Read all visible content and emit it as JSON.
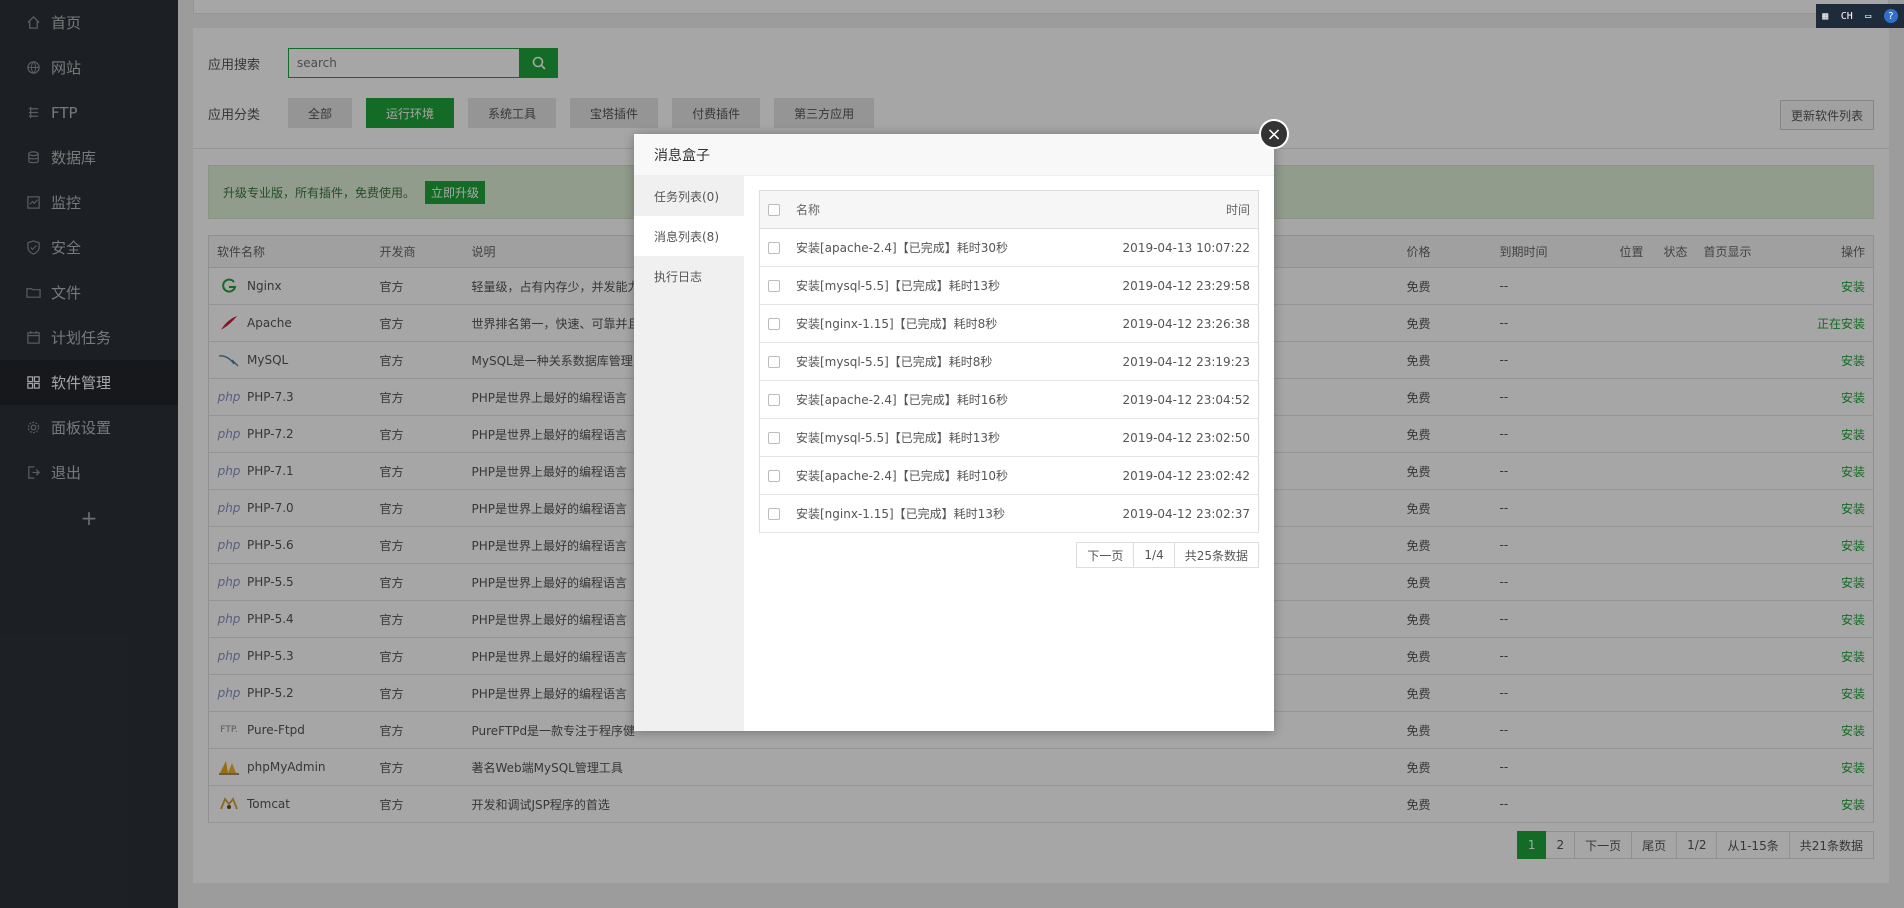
{
  "sidebar": {
    "items": [
      {
        "label": "首页",
        "icon": "home-icon"
      },
      {
        "label": "网站",
        "icon": "globe-icon"
      },
      {
        "label": "FTP",
        "icon": "ftp-icon"
      },
      {
        "label": "数据库",
        "icon": "database-icon"
      },
      {
        "label": "监控",
        "icon": "monitor-icon"
      },
      {
        "label": "安全",
        "icon": "shield-icon"
      },
      {
        "label": "文件",
        "icon": "folder-icon"
      },
      {
        "label": "计划任务",
        "icon": "calendar-icon"
      },
      {
        "label": "软件管理",
        "icon": "grid-icon",
        "active": true
      },
      {
        "label": "面板设置",
        "icon": "gear-icon"
      },
      {
        "label": "退出",
        "icon": "logout-icon"
      }
    ],
    "add_label": "+"
  },
  "search": {
    "label": "应用搜索",
    "placeholder": "search"
  },
  "categories": {
    "label": "应用分类",
    "items": [
      "全部",
      "运行环境",
      "系统工具",
      "宝塔插件",
      "付费插件",
      "第三方应用"
    ],
    "active": "运行环境"
  },
  "refresh_label": "更新软件列表",
  "promo": {
    "text": "升级专业版，所有插件，免费使用。",
    "button": "立即升级"
  },
  "software_table": {
    "headers": {
      "name": "软件名称",
      "vendor": "开发商",
      "desc": "说明",
      "price": "价格",
      "expire": "到期时间",
      "location": "位置",
      "status": "状态",
      "homepage": "首页显示",
      "action": "操作"
    },
    "rows": [
      {
        "name": "Nginx",
        "vendor": "官方",
        "desc": "轻量级，占有内存少，并发能力",
        "price": "免费",
        "expire": "--",
        "action": "安装",
        "logo": "G"
      },
      {
        "name": "Apache",
        "vendor": "官方",
        "desc": "世界排名第一，快速、可靠并且",
        "price": "免费",
        "expire": "--",
        "action": "正在安装",
        "logo": "feather"
      },
      {
        "name": "MySQL",
        "vendor": "官方",
        "desc": "MySQL是一种关系数据库管理",
        "price": "免费",
        "expire": "--",
        "action": "安装",
        "logo": "dolphin"
      },
      {
        "name": "PHP-7.3",
        "vendor": "官方",
        "desc": "PHP是世界上最好的编程语言",
        "price": "免费",
        "expire": "--",
        "action": "安装",
        "logo": "php"
      },
      {
        "name": "PHP-7.2",
        "vendor": "官方",
        "desc": "PHP是世界上最好的编程语言",
        "price": "免费",
        "expire": "--",
        "action": "安装",
        "logo": "php"
      },
      {
        "name": "PHP-7.1",
        "vendor": "官方",
        "desc": "PHP是世界上最好的编程语言",
        "price": "免费",
        "expire": "--",
        "action": "安装",
        "logo": "php"
      },
      {
        "name": "PHP-7.0",
        "vendor": "官方",
        "desc": "PHP是世界上最好的编程语言",
        "price": "免费",
        "expire": "--",
        "action": "安装",
        "logo": "php"
      },
      {
        "name": "PHP-5.6",
        "vendor": "官方",
        "desc": "PHP是世界上最好的编程语言",
        "price": "免费",
        "expire": "--",
        "action": "安装",
        "logo": "php"
      },
      {
        "name": "PHP-5.5",
        "vendor": "官方",
        "desc": "PHP是世界上最好的编程语言",
        "price": "免费",
        "expire": "--",
        "action": "安装",
        "logo": "php"
      },
      {
        "name": "PHP-5.4",
        "vendor": "官方",
        "desc": "PHP是世界上最好的编程语言",
        "price": "免费",
        "expire": "--",
        "action": "安装",
        "logo": "php"
      },
      {
        "name": "PHP-5.3",
        "vendor": "官方",
        "desc": "PHP是世界上最好的编程语言",
        "price": "免费",
        "expire": "--",
        "action": "安装",
        "logo": "php"
      },
      {
        "name": "PHP-5.2",
        "vendor": "官方",
        "desc": "PHP是世界上最好的编程语言",
        "price": "免费",
        "expire": "--",
        "action": "安装",
        "logo": "php"
      },
      {
        "name": "Pure-Ftpd",
        "vendor": "官方",
        "desc": "PureFTPd是一款专注于程序健",
        "price": "免费",
        "expire": "--",
        "action": "安装",
        "logo": "FTP"
      },
      {
        "name": "phpMyAdmin",
        "vendor": "官方",
        "desc": "著名Web端MySQL管理工具",
        "price": "免费",
        "expire": "--",
        "action": "安装",
        "logo": "sail"
      },
      {
        "name": "Tomcat",
        "vendor": "官方",
        "desc": "开发和调试JSP程序的首选",
        "price": "免费",
        "expire": "--",
        "action": "安装",
        "logo": "cat"
      }
    ]
  },
  "pager": {
    "items": [
      "1",
      "2",
      "下一页",
      "尾页",
      "1/2",
      "从1-15条",
      "共21条数据"
    ],
    "current": "1"
  },
  "modal": {
    "title": "消息盒子",
    "close": "×",
    "tabs": [
      "任务列表(0)",
      "消息列表(8)",
      "执行日志"
    ],
    "active_tab": "消息列表(8)",
    "table_headers": {
      "name": "名称",
      "time": "时间"
    },
    "messages": [
      {
        "name": "安装[apache-2.4]【已完成】耗时30秒",
        "time": "2019-04-13 10:07:22"
      },
      {
        "name": "安装[mysql-5.5]【已完成】耗时13秒",
        "time": "2019-04-12 23:29:58"
      },
      {
        "name": "安装[nginx-1.15]【已完成】耗时8秒",
        "time": "2019-04-12 23:26:38"
      },
      {
        "name": "安装[mysql-5.5]【已完成】耗时8秒",
        "time": "2019-04-12 23:19:23"
      },
      {
        "name": "安装[apache-2.4]【已完成】耗时16秒",
        "time": "2019-04-12 23:04:52"
      },
      {
        "name": "安装[mysql-5.5]【已完成】耗时13秒",
        "time": "2019-04-12 23:02:50"
      },
      {
        "name": "安装[apache-2.4]【已完成】耗时10秒",
        "time": "2019-04-12 23:02:42"
      },
      {
        "name": "安装[nginx-1.15]【已完成】耗时13秒",
        "time": "2019-04-12 23:02:37"
      }
    ],
    "pager": [
      "下一页",
      "1/4",
      "共25条数据"
    ]
  },
  "tray": {
    "lang": "CH",
    "help": "?"
  },
  "colors": {
    "accent": "#20a53a",
    "sidebar_bg": "#2c3138"
  }
}
